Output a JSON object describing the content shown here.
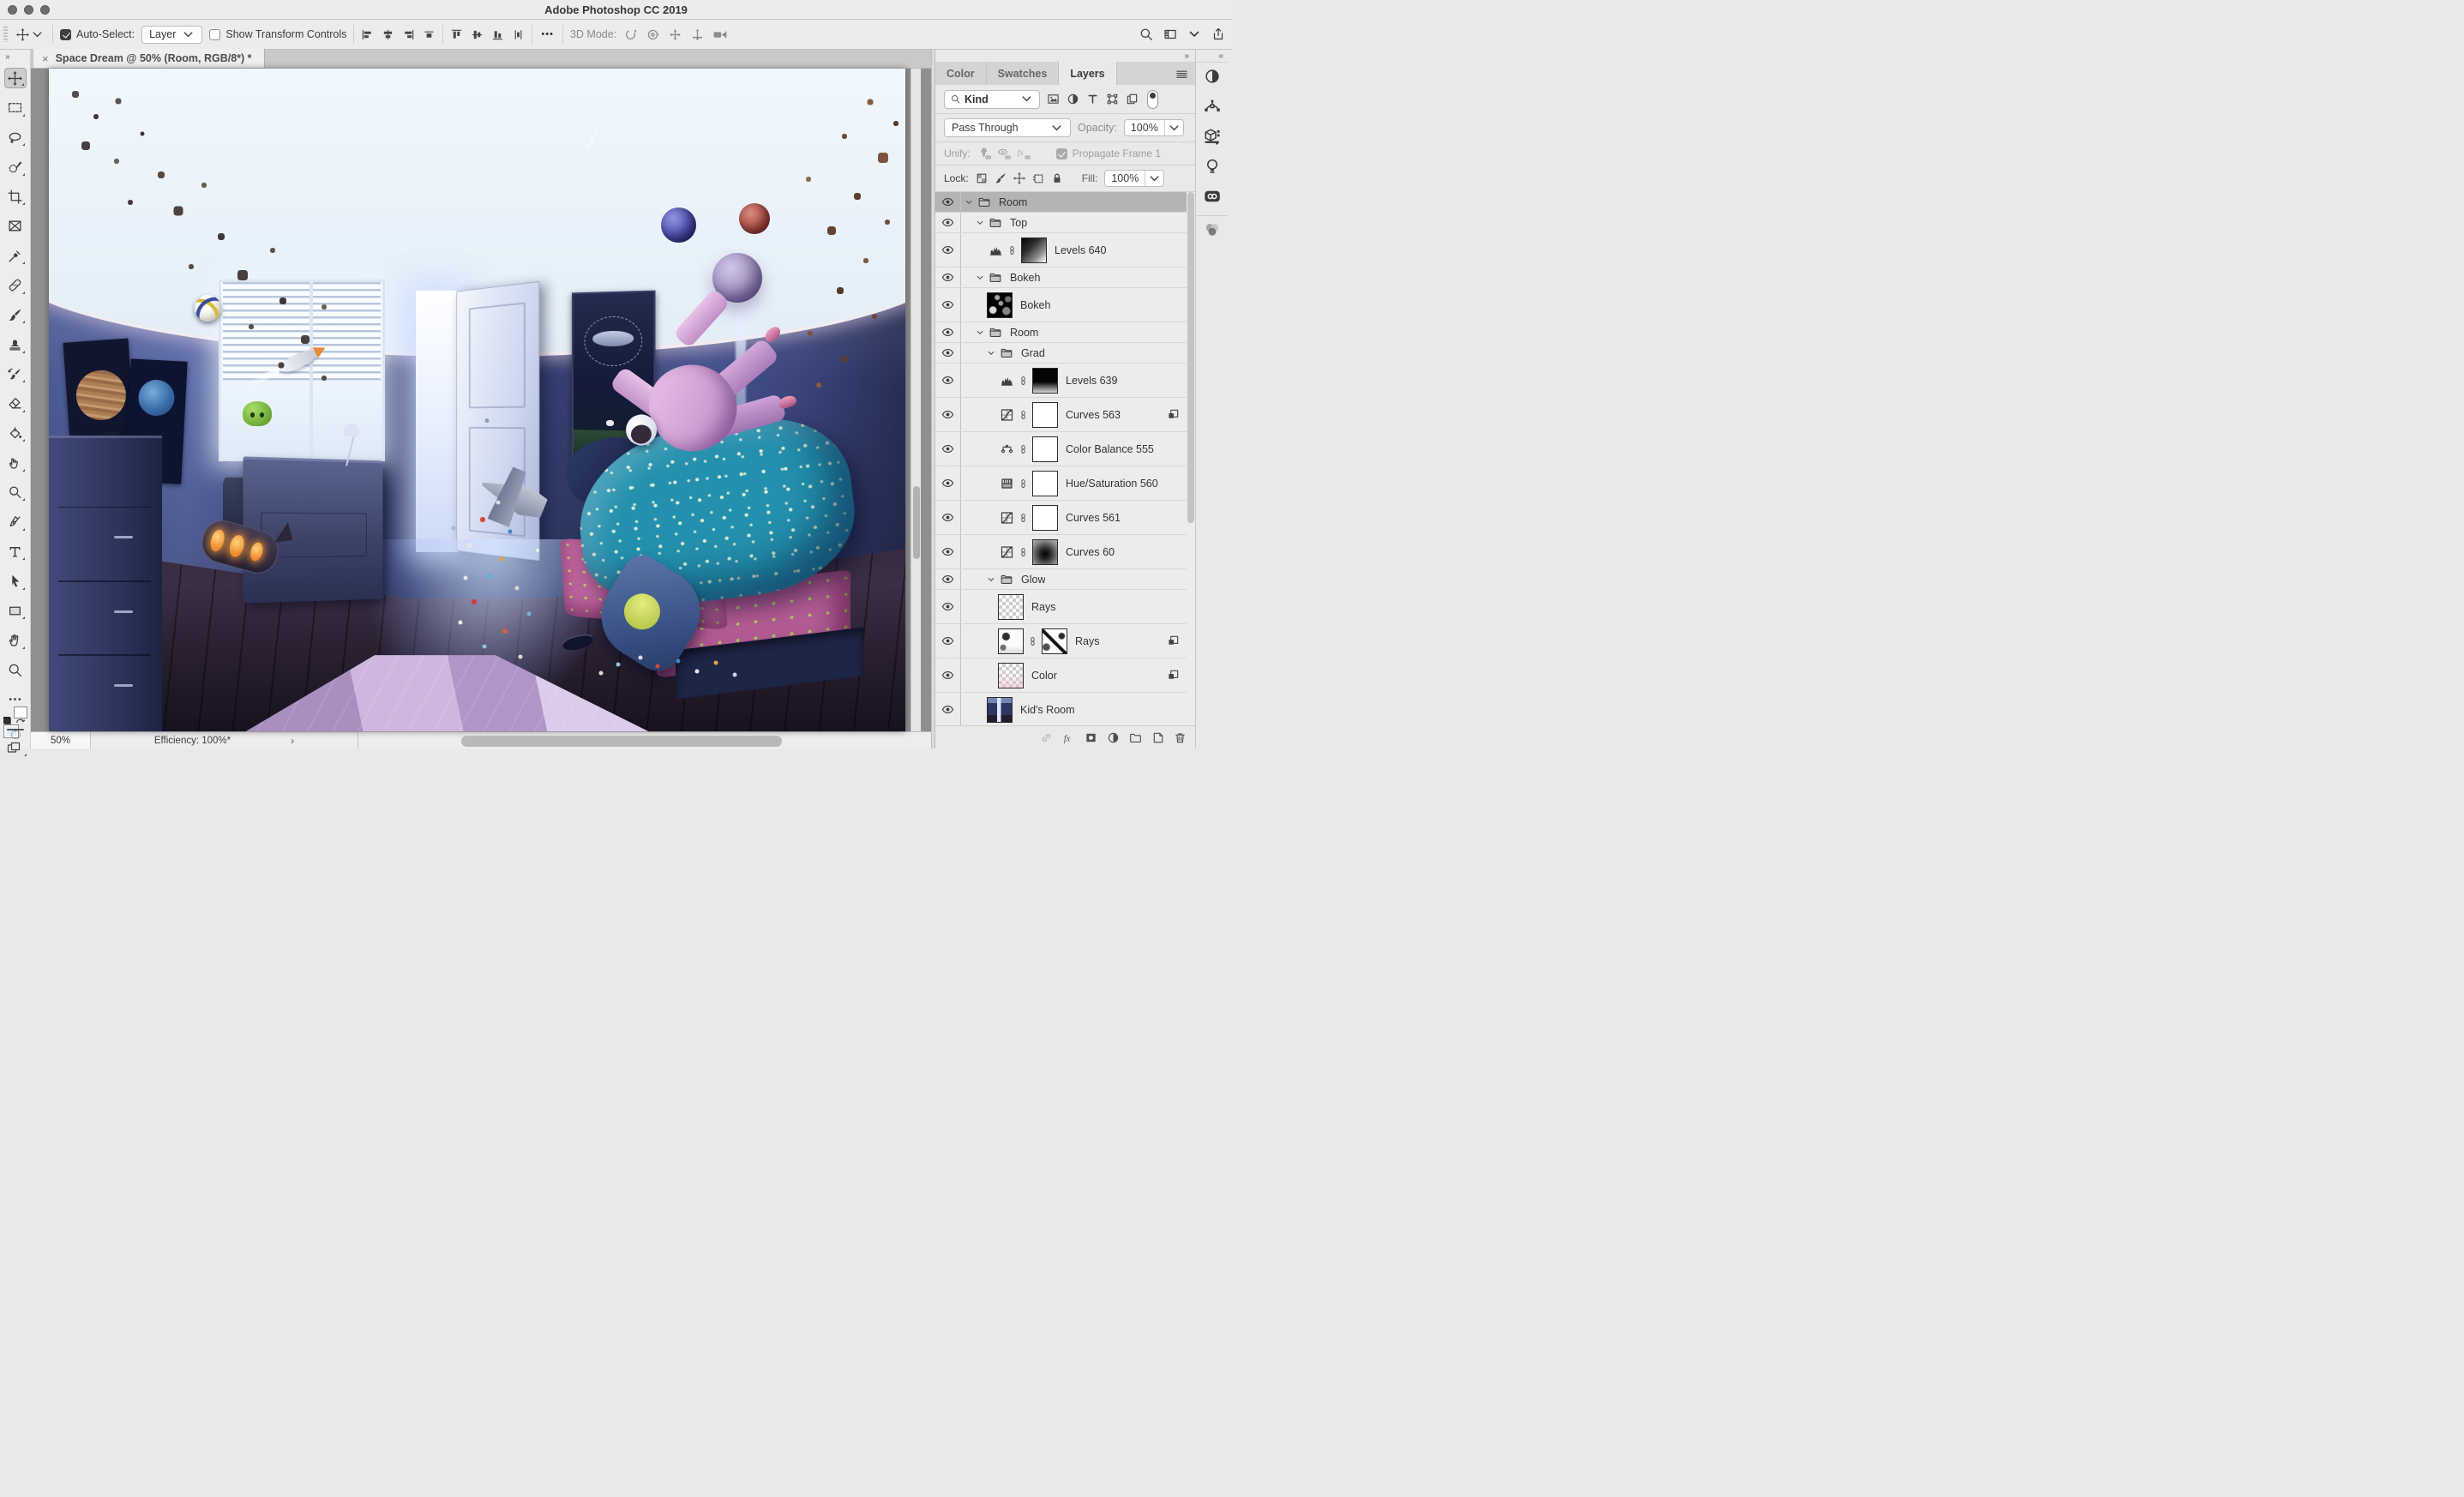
{
  "window": {
    "title": "Adobe Photoshop CC 2019"
  },
  "options_bar": {
    "auto_select": {
      "label": "Auto-Select:",
      "value": "Layer",
      "checked": true
    },
    "show_transform": {
      "label": "Show Transform Controls",
      "checked": false
    },
    "align_icons": [
      "align-left",
      "align-center-h",
      "align-right",
      "distribute-h"
    ],
    "distribute_icons": [
      "align-top",
      "align-center-v",
      "align-bottom",
      "distribute-v"
    ],
    "ellipsis": "•••",
    "mode_3d": {
      "label": "3D Mode:",
      "icons": [
        "3d-orbit",
        "3d-roll",
        "3d-pan",
        "3d-slide",
        "3d-camera"
      ]
    },
    "right_icons": [
      "search",
      "workspace",
      "chevron-down",
      "share"
    ]
  },
  "document_tab": {
    "close": "×",
    "title": "Space Dream @ 50% (Room, RGB/8*) *"
  },
  "toolbar": {
    "expand": "»",
    "tools": [
      {
        "icon": "move",
        "selected": true
      },
      {
        "icon": "marquee"
      },
      {
        "icon": "lasso"
      },
      {
        "icon": "quickselect"
      },
      {
        "icon": "crop"
      },
      {
        "icon": "frame"
      },
      {
        "icon": "eyedropper"
      },
      {
        "icon": "healing"
      },
      {
        "icon": "brush"
      },
      {
        "icon": "stamp"
      },
      {
        "icon": "history"
      },
      {
        "icon": "eraser"
      },
      {
        "icon": "bucket"
      },
      {
        "icon": "smudge"
      },
      {
        "icon": "dodge"
      },
      {
        "icon": "pen"
      },
      {
        "icon": "type"
      },
      {
        "icon": "pathselect"
      },
      {
        "icon": "rect"
      },
      {
        "icon": "hand"
      },
      {
        "icon": "zoom"
      },
      {
        "icon": "dots"
      }
    ],
    "foreground_color": "#dceefb",
    "background_color": "#ffffff"
  },
  "panels": {
    "collapse": "»",
    "tabs": [
      {
        "label": "Color"
      },
      {
        "label": "Swatches"
      },
      {
        "label": "Layers",
        "active": true
      }
    ],
    "filter": {
      "kind_label": "Kind",
      "icons": [
        "filter-pixel",
        "filter-adjust",
        "filter-type",
        "filter-shape",
        "filter-smart"
      ]
    },
    "blend": {
      "mode": "Pass Through",
      "opacity_label": "Opacity:",
      "opacity_value": "100%"
    },
    "unify": {
      "label": "Unify:",
      "icons": [
        "unify-pin",
        "unify-eye",
        "unify-fx"
      ],
      "propagate_label": "Propagate Frame 1",
      "propagate_checked": true
    },
    "lock": {
      "label": "Lock:",
      "icons": [
        "lock-transparent",
        "lock-pixels",
        "lock-move",
        "lock-artboard",
        "lock-all"
      ],
      "fill_label": "Fill:",
      "fill_value": "100%"
    },
    "layers": [
      {
        "name": "Room",
        "kind": "group",
        "indent": 0,
        "selected": true
      },
      {
        "name": "Top",
        "kind": "group",
        "indent": 1
      },
      {
        "name": "Levels 640",
        "kind": "adjustment",
        "icon": "levels",
        "indent": 2,
        "link": true,
        "mask": "grad-diag"
      },
      {
        "name": "Bokeh",
        "kind": "group",
        "indent": 1
      },
      {
        "name": "Bokeh",
        "kind": "pixel",
        "indent": 2,
        "thumb": "bokeh"
      },
      {
        "name": "Room",
        "kind": "group",
        "indent": 1
      },
      {
        "name": "Grad",
        "kind": "group",
        "indent": 2
      },
      {
        "name": "Levels 639",
        "kind": "adjustment",
        "icon": "levels",
        "indent": 3,
        "link": true,
        "mask": "grad-vert"
      },
      {
        "name": "Curves 563",
        "kind": "adjustment",
        "icon": "curves",
        "indent": 3,
        "link": true,
        "mask": "white",
        "badge": true
      },
      {
        "name": "Color Balance 555",
        "kind": "adjustment",
        "icon": "balance",
        "indent": 3,
        "link": true,
        "mask": "white"
      },
      {
        "name": "Hue/Saturation 560",
        "kind": "adjustment",
        "icon": "hue",
        "indent": 3,
        "link": true,
        "mask": "white"
      },
      {
        "name": "Curves 561",
        "kind": "adjustment",
        "icon": "curves",
        "indent": 3,
        "link": true,
        "mask": "white"
      },
      {
        "name": "Curves 60",
        "kind": "adjustment",
        "icon": "curves",
        "indent": 3,
        "link": true,
        "mask": "vignette"
      },
      {
        "name": "Glow",
        "kind": "group",
        "indent": 2
      },
      {
        "name": "Rays",
        "kind": "pixel",
        "indent": 3,
        "thumb": "checker"
      },
      {
        "name": "Rays",
        "kind": "pixel",
        "indent": 3,
        "thumb": "rays",
        "link": true,
        "mask": "rays-mask",
        "badge": true
      },
      {
        "name": "Color",
        "kind": "pixel",
        "indent": 3,
        "thumb": "checker-pink",
        "badge": true
      },
      {
        "name": "Kid's Room",
        "kind": "pixel",
        "indent": 2,
        "thumb": "kids-room"
      }
    ],
    "bottom_icons": [
      "chain",
      "fx",
      "mask",
      "adjust",
      "newfolder",
      "newlayer",
      "trash"
    ]
  },
  "right_strip": {
    "collapse": "«",
    "icons_top": [
      "filter-adjust",
      "paths",
      "cube3d",
      "bulb",
      "cc"
    ],
    "icons_bottom": [
      "channels"
    ]
  },
  "status_bar": {
    "zoom": "50%",
    "efficiency": "Efficiency: 100%*",
    "chevron": "›"
  }
}
